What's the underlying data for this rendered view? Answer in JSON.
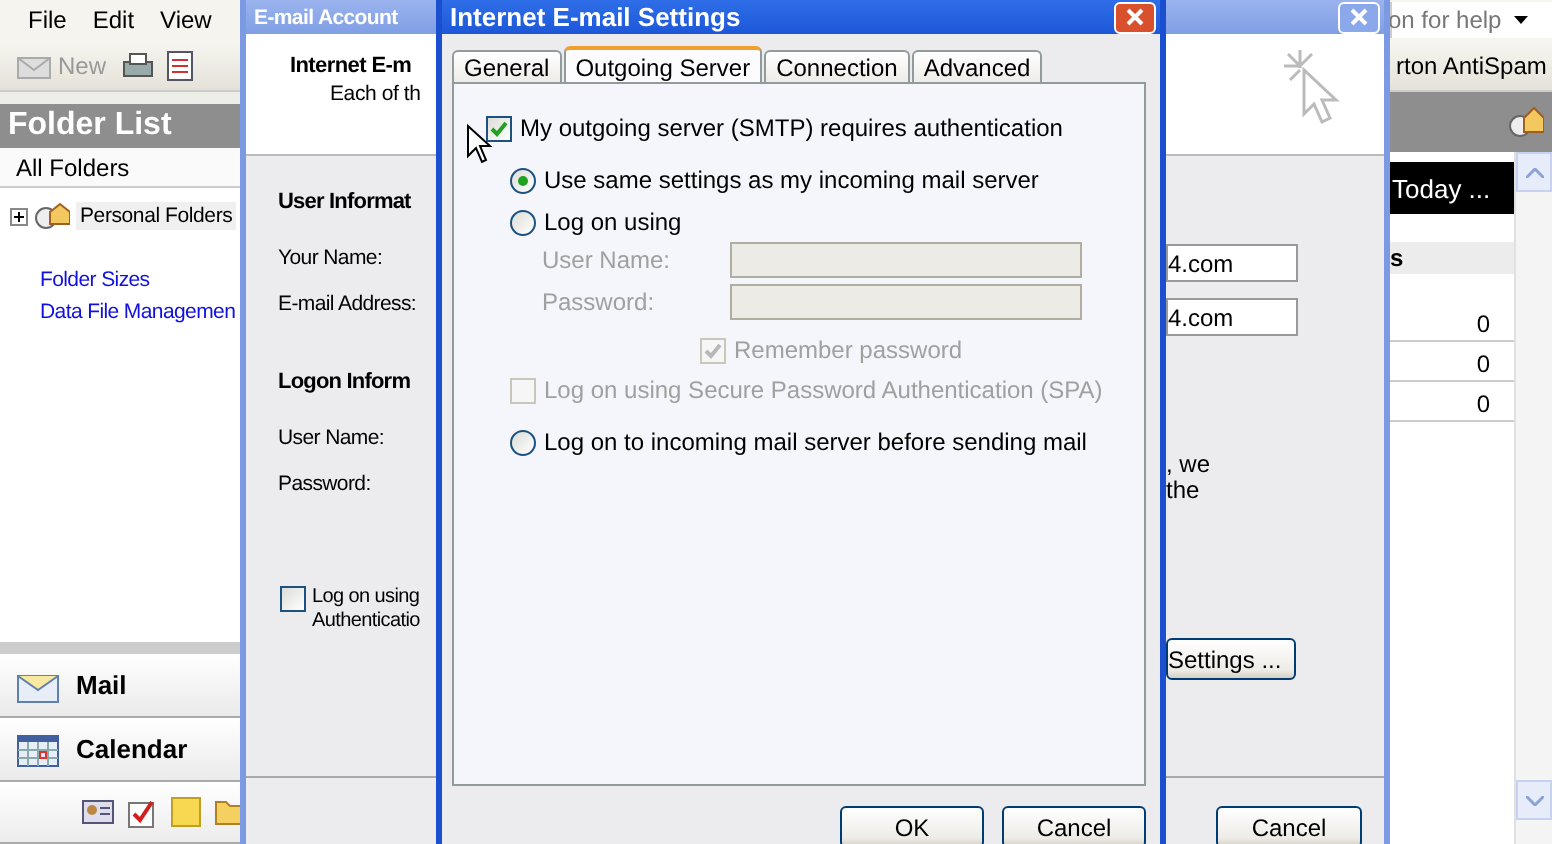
{
  "outlook": {
    "menu": [
      "File",
      "Edit",
      "View"
    ],
    "toolbar": {
      "new_label": "New"
    },
    "help_box": "on for help",
    "antispam": "rton AntiSpam",
    "folder_list": {
      "title": "Folder List",
      "all_folders": "All Folders",
      "tree": [
        {
          "label": "Personal Folders",
          "expanded": false
        }
      ],
      "links": [
        "Folder Sizes",
        "Data File Managemen"
      ]
    },
    "nav": [
      {
        "label": "Mail",
        "kind": "mail"
      },
      {
        "label": "Calendar",
        "kind": "calendar"
      }
    ],
    "today": {
      "header": "Today ...",
      "column": "s",
      "rows": [
        "0",
        "0",
        "0"
      ]
    }
  },
  "accounts_dialog": {
    "title": "E-mail Account",
    "header_title": "Internet E-m",
    "header_text": "Each of th",
    "sections": [
      {
        "heading": "User Informat",
        "fields": [
          {
            "label": "Your Name:",
            "value": "4.com"
          },
          {
            "label": "E-mail Address:",
            "value": "4.com"
          }
        ]
      },
      {
        "heading": "Logon Inform",
        "fields": [
          {
            "label": "User Name:"
          },
          {
            "label": "Password:"
          }
        ]
      }
    ],
    "note": [
      ", we",
      "the"
    ],
    "spa_checkbox": {
      "lines": [
        "Log on using",
        "Authenticatio"
      ],
      "checked": false
    },
    "more_button": "Settings ...",
    "buttons": [
      "Cancel"
    ]
  },
  "settings_dialog": {
    "title": "Internet E-mail Settings",
    "tabs": [
      {
        "label": "General",
        "selected": false
      },
      {
        "label": "Outgoing Server",
        "selected": true
      },
      {
        "label": "Connection",
        "selected": false
      },
      {
        "label": "Advanced",
        "selected": false
      }
    ],
    "options": [
      {
        "kind": "checkbox",
        "label": "My outgoing server (SMTP) requires authentication",
        "checked": true,
        "disabled": false,
        "children": [
          {
            "kind": "radio",
            "label": "Use same settings as my incoming mail server",
            "selected": true
          },
          {
            "kind": "radio",
            "label": "Log on using",
            "selected": false,
            "children": [
              {
                "kind": "field",
                "label": "User Name:",
                "disabled": true
              },
              {
                "kind": "field",
                "label": "Password:",
                "disabled": true
              },
              {
                "kind": "field_checkbox",
                "label": "Remember password",
                "checked": true,
                "disabled": true
              },
              {
                "kind": "checkbox",
                "label": "Log on using Secure Password Authentication (SPA)",
                "checked": false,
                "disabled": true
              }
            ]
          },
          {
            "kind": "radio",
            "label": "Log on to incoming mail server before sending mail",
            "selected": false
          }
        ]
      }
    ],
    "buttons": [
      {
        "label": "OK"
      },
      {
        "label": "Cancel"
      }
    ]
  }
}
